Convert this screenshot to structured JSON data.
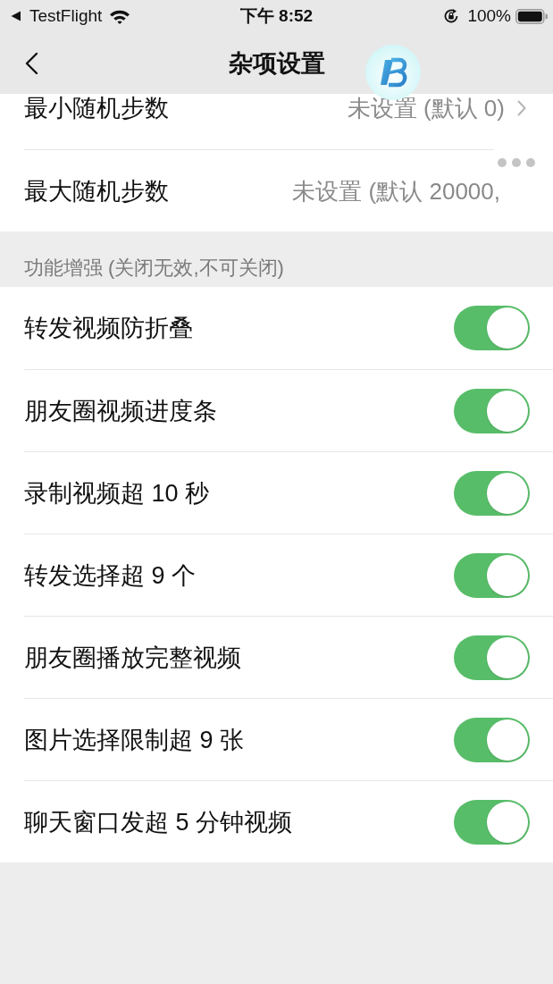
{
  "status_bar": {
    "back_app": "TestFlight",
    "time": "下午 8:52",
    "battery_percent": "100%"
  },
  "nav_bar": {
    "title": "杂项设置"
  },
  "rows": [
    {
      "kind": "link",
      "label": "最小随机步数",
      "value": "未设置 (默认 0)"
    },
    {
      "kind": "value",
      "label": "最大随机步数",
      "value": "未设置 (默认 20000,"
    }
  ],
  "section": {
    "title": "功能增强 (关闭无效,不可关闭)",
    "items": [
      {
        "label": "转发视频防折叠",
        "on": true
      },
      {
        "label": "朋友圈视频进度条",
        "on": true
      },
      {
        "label": "录制视频超 10 秒",
        "on": true
      },
      {
        "label": "转发选择超 9 个",
        "on": true
      },
      {
        "label": "朋友圈播放完整视频",
        "on": true
      },
      {
        "label": "图片选择限制超 9 张",
        "on": true
      },
      {
        "label": "聊天窗口发超 5 分钟视频",
        "on": true
      }
    ]
  }
}
